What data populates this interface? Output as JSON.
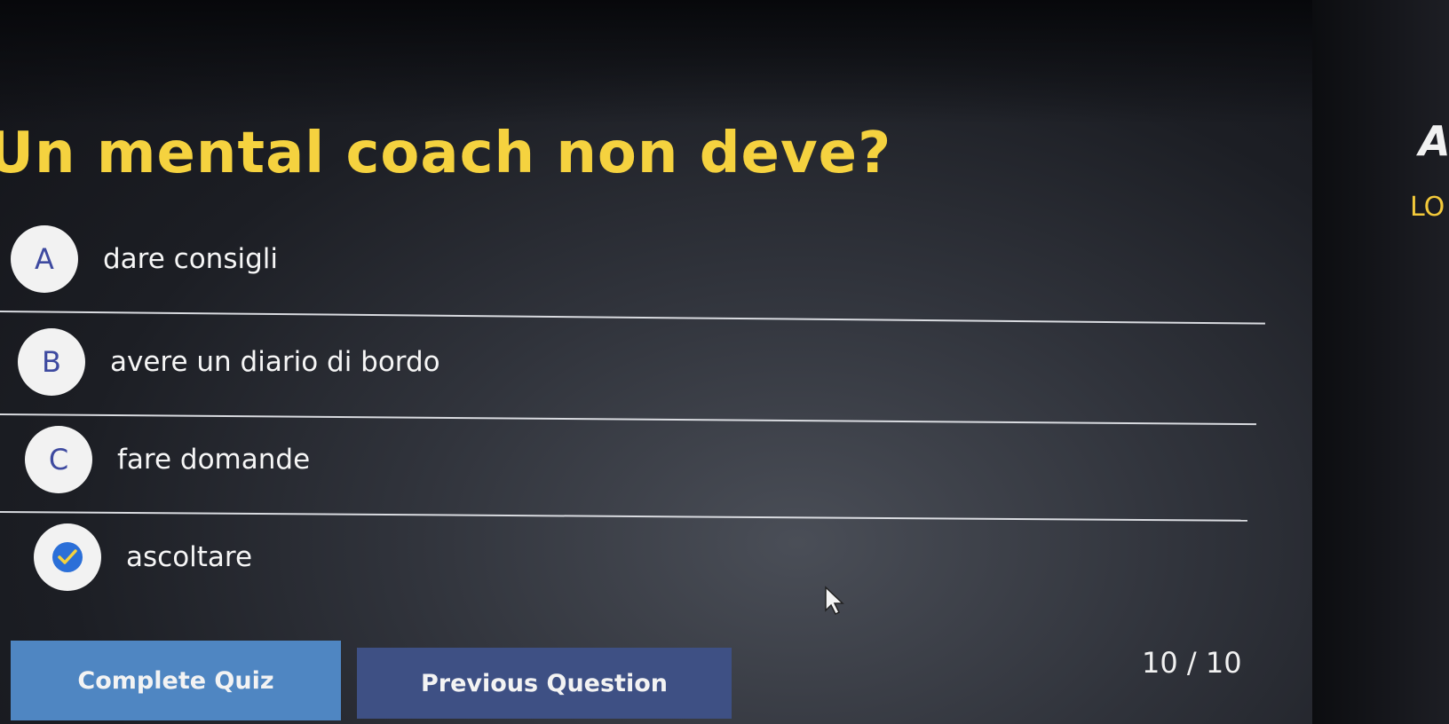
{
  "quiz": {
    "question": "Un mental coach non deve?",
    "options": [
      {
        "letter": "A",
        "text": "dare consigli",
        "selected": false
      },
      {
        "letter": "B",
        "text": "avere un diario di bordo",
        "selected": false
      },
      {
        "letter": "C",
        "text": "fare domande",
        "selected": false
      },
      {
        "letter": "",
        "text": "ascoltare",
        "selected": true
      }
    ],
    "complete_label": "Complete Quiz",
    "previous_label": "Previous Question",
    "progress": "10 / 10"
  },
  "side_panel": {
    "heading_fragment": "A",
    "label_fragment": "LO"
  },
  "colors": {
    "question_text": "#f5d23f",
    "complete_button": "#4f86c2",
    "previous_button": "#3e5084",
    "check": "#2b6fd8"
  },
  "icons": {
    "selected_option": "check-icon",
    "pointer": "cursor-icon"
  }
}
